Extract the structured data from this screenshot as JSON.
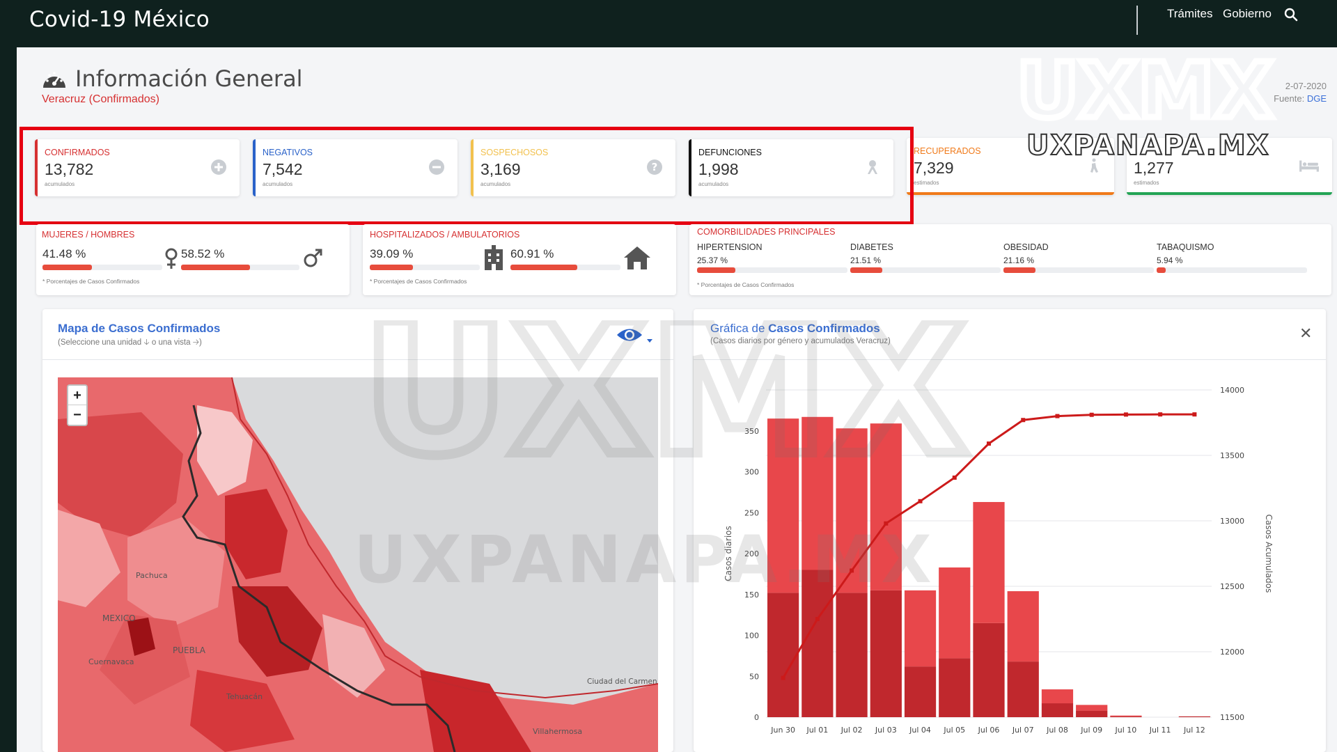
{
  "app": {
    "brand": "Covid-19 México",
    "nav": [
      "Trámites",
      "Gobierno"
    ]
  },
  "header": {
    "title": "Información General",
    "subtitle": "Veracruz (Confirmados)",
    "date_label": "2-07-2020",
    "source_label": "Fuente:",
    "source_link": "DGE"
  },
  "stats": [
    {
      "label": "CONFIRMADOS",
      "value": "13,782",
      "sub": "acumulados",
      "color": "#d63031",
      "icon": "plus-circle-icon"
    },
    {
      "label": "NEGATIVOS",
      "value": "7,542",
      "sub": "acumulados",
      "color": "#2a62c9",
      "icon": "minus-circle-icon"
    },
    {
      "label": "SOSPECHOSOS",
      "value": "3,169",
      "sub": "acumulados",
      "color": "#f2c14e",
      "icon": "question-circle-icon"
    },
    {
      "label": "DEFUNCIONES",
      "value": "1,998",
      "sub": "acumulados",
      "color": "#111111",
      "icon": "skull-icon"
    },
    {
      "label": "RECUPERADOS",
      "value": "7,329",
      "sub": "estimados",
      "color": "#f07a1a",
      "icon": "walking-icon"
    },
    {
      "label": "",
      "value": "1,277",
      "sub": "estimados",
      "color": "#23a455",
      "icon": "bed-icon"
    }
  ],
  "gender": {
    "title": "MUJERES / HOMBRES",
    "women_pct": "41.48 %",
    "men_pct": "58.52 %",
    "women_value": 41.48,
    "men_value": 58.52,
    "note": "* Porcentajes  de Casos Confirmados"
  },
  "hospital": {
    "title": "HOSPITALIZADOS / AMBULATORIOS",
    "hosp_pct": "39.09 %",
    "amb_pct": "60.91 %",
    "hosp_value": 39.09,
    "amb_value": 60.91,
    "note": "* Porcentajes  de Casos Confirmados"
  },
  "comorbidities": {
    "title": "COMORBILIDADES PRINCIPALES",
    "items": [
      {
        "label": "HIPERTENSION",
        "pct": "25.37 %",
        "value": 25.37
      },
      {
        "label": "DIABETES",
        "pct": "21.51 %",
        "value": 21.51
      },
      {
        "label": "OBESIDAD",
        "pct": "21.16 %",
        "value": 21.16
      },
      {
        "label": "TABAQUISMO",
        "pct": "5.94 %",
        "value": 5.94
      }
    ],
    "note": "* Porcentajes  de Casos Confirmados"
  },
  "map_panel": {
    "title": "Mapa de Casos Confirmados",
    "subtitle": "(Seleccione una unidad 🡣 o una vista 🡢)",
    "zoom_in": "+",
    "zoom_out": "−",
    "places": [
      "Pachuca",
      "MEXICO",
      "PUEBLA",
      "Cuernavaca",
      "Tehuacán",
      "Ciudad del Carmen",
      "Villahermosa"
    ]
  },
  "chart_panel": {
    "title_prefix": "Gráfica de ",
    "title_bold": "Casos Confirmados",
    "subtitle": "(Casos diarios por género y acumulados Veracruz)"
  },
  "watermark": {
    "big": "UXMX",
    "text": "UXPANAPA.MX"
  },
  "chart_data": {
    "type": "bar",
    "categories": [
      "Jun 30",
      "Jul 01",
      "Jul 02",
      "Jul 03",
      "Jul 04",
      "Jul 05",
      "Jul 06",
      "Jul 07",
      "Jul 08",
      "Jul 09",
      "Jul 10",
      "Jul 11",
      "Jul 12"
    ],
    "series": [
      {
        "values": [
          152,
          180,
          152,
          155,
          62,
          72,
          115,
          68,
          17,
          8,
          1,
          0,
          1
        ],
        "color": "#c0282d"
      },
      {
        "values": [
          213,
          187,
          201,
          204,
          93,
          111,
          148,
          86,
          17,
          7,
          1,
          0,
          0
        ],
        "color": "#e8474b"
      },
      {
        "values": [
          11800,
          12250,
          12620,
          12980,
          13150,
          13330,
          13590,
          13770,
          13800,
          13810,
          13812,
          13813,
          13813
        ],
        "color": "#cc1a1a",
        "axis": "right",
        "kind": "line"
      }
    ],
    "ylabel": "Casos diarios",
    "ylabel_right": "Casos Acumulados",
    "yticks": [
      0,
      50,
      100,
      150,
      200,
      250,
      300,
      350
    ],
    "yticks_right": [
      11500,
      12000,
      12500,
      13000,
      13500,
      14000
    ],
    "ylim": [
      0,
      400
    ],
    "ylim_right": [
      11500,
      14000
    ]
  }
}
